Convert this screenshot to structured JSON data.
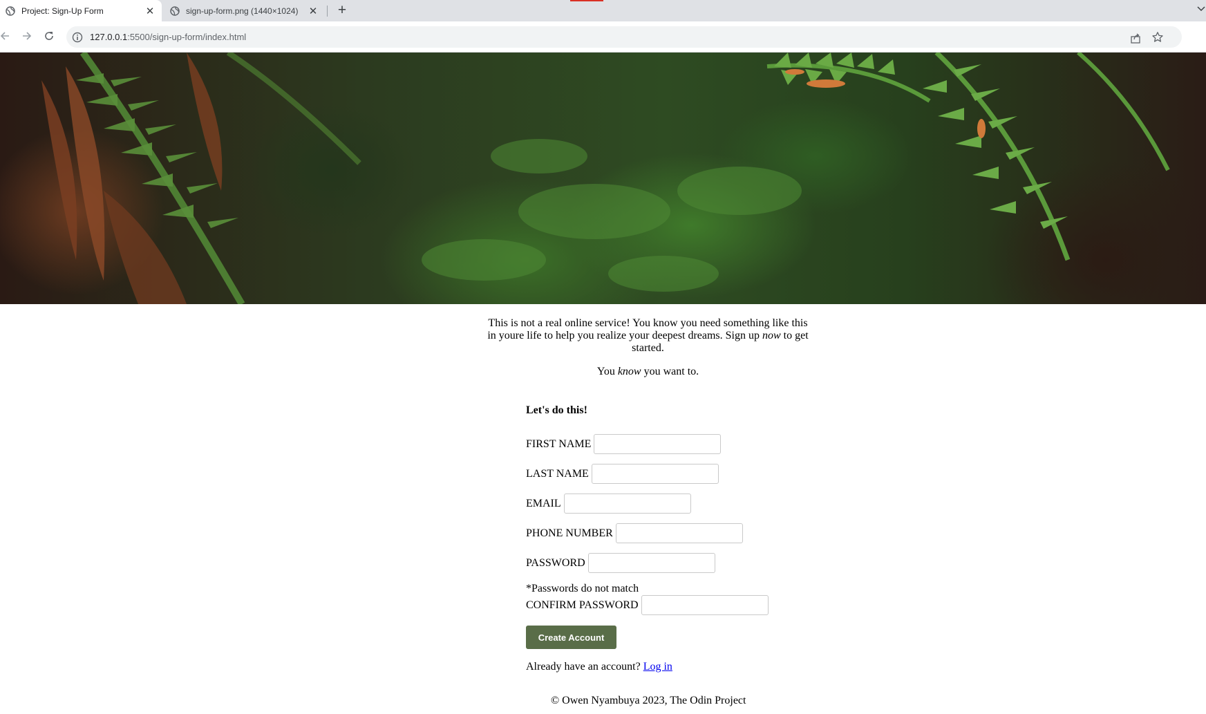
{
  "browser": {
    "tabs": [
      {
        "title": "Project: Sign-Up Form",
        "active": true
      },
      {
        "title": "sign-up-form.png (1440×1024)",
        "active": false
      }
    ],
    "new_tab_label": "+",
    "url_host": "127.0.0.1",
    "url_path": ":5500/sign-up-form/index.html",
    "icons": [
      "globe-icon",
      "close-icon",
      "back-icon",
      "forward-icon",
      "reload-icon",
      "info-icon",
      "share-icon",
      "star-icon"
    ]
  },
  "intro": {
    "p1_start": "This is not a real online service! You know you need something like this in youre life to help you realize your deepest dreams. Sign up ",
    "p1_em": "now",
    "p1_end": " to get started.",
    "p2_start": "You ",
    "p2_em": "know",
    "p2_end": " you want to."
  },
  "form": {
    "heading": "Let's do this!",
    "fields": [
      {
        "label": "FIRST NAME",
        "value": ""
      },
      {
        "label": "LAST NAME",
        "value": ""
      },
      {
        "label": "EMAIL",
        "value": ""
      },
      {
        "label": "PHONE NUMBER",
        "value": ""
      },
      {
        "label": "PASSWORD",
        "value": ""
      },
      {
        "label": "CONFIRM PASSWORD",
        "value": ""
      }
    ],
    "error": "*Passwords do not match",
    "submit_label": "Create Account",
    "login_prompt": "Already have an account?",
    "login_link": "Log in"
  },
  "footer": {
    "text": "© Owen Nyambuya 2023, The Odin Project"
  },
  "colors": {
    "button_bg": "#596d48",
    "link": "#0000ee",
    "tabbar_bg": "#dfe1e5"
  }
}
